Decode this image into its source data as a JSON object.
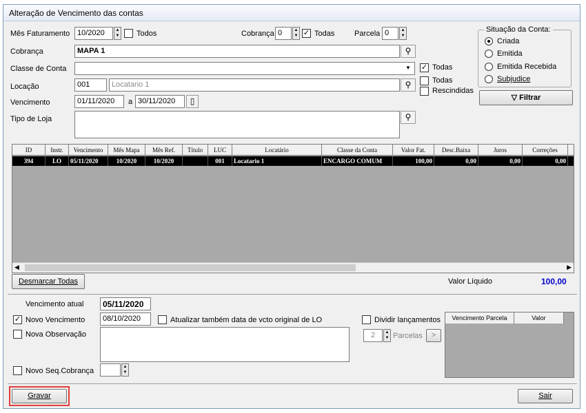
{
  "window": {
    "title": "Alteração de Vencimento das contas"
  },
  "filters": {
    "mes_faturamento_label": "Mês Faturamento",
    "mes_faturamento_value": "10/2020",
    "todos_label": "Todos",
    "cobranca_num_label": "Cobrança",
    "cobranca_num_value": "0",
    "todas_label": "Todas",
    "parcela_label": "Parcela",
    "parcela_value": "0",
    "cobranca_label": "Cobrança",
    "cobranca_value": "MAPA 1",
    "classe_label": "Classe de Conta",
    "classe_value": "",
    "classe_todas_label": "Todas",
    "locacao_label": "Locação",
    "locacao_code": "001",
    "locacao_name": "Locatario 1",
    "locacao_todas_label": "Todas",
    "rescindidas_label": "Rescindidas",
    "vencimento_label": "Vencimento",
    "vencimento_from": "01/11/2020",
    "vencimento_sep": "a",
    "vencimento_to": "30/11/2020",
    "tipo_loja_label": "Tipo de Loja"
  },
  "situacao": {
    "title": "Situação da Conta:",
    "options": [
      "Criada",
      "Emitida",
      "Emitida Recebida",
      "Subjudice"
    ],
    "selected": "Criada"
  },
  "filtrar_label": "Filtrar",
  "grid": {
    "columns": [
      "ID",
      "Instr.",
      "Vencimento",
      "Mês Mapa",
      "Mês Ref.",
      "Título",
      "LUC",
      "Locatário",
      "Classe da Conta",
      "Valor Fat.",
      "Desc.Baixa",
      "Juros",
      "Correções"
    ],
    "rows": [
      [
        "394",
        "LO",
        "05/11/2020",
        "10/2020",
        "10/2020",
        "",
        "001",
        "Locatario 1",
        "ENCARGO COMUM",
        "100,00",
        "0,00",
        "0,00",
        "0,00"
      ]
    ]
  },
  "desmarcar_label": "Desmarcar Todas",
  "valor_liquido_label": "Valor Líquido",
  "valor_liquido_value": "100,00",
  "bottom": {
    "vencimento_atual_label": "Vencimento atual",
    "vencimento_atual_value": "05/11/2020",
    "novo_vencimento_label": "Novo Vencimento",
    "novo_vencimento_value": "08/10/2020",
    "atualizar_label": "Atualizar também data de vcto original de LO",
    "nova_observacao_label": "Nova Observação",
    "novo_seq_label": "Novo Seq.Cobrança",
    "dividir_label": "Dividir lançamentos",
    "parcelas_value": "2",
    "parcelas_label": "Parcelas",
    "parcelas_next": ">",
    "mini_columns": [
      "Vencimento Parcela",
      "Valor"
    ]
  },
  "gravar_label": "Gravar",
  "sair_label": "Sair",
  "colors": {
    "accent_blue": "#0000cc",
    "selected_row": "#000000",
    "highlight_border": "#e23a3a"
  }
}
